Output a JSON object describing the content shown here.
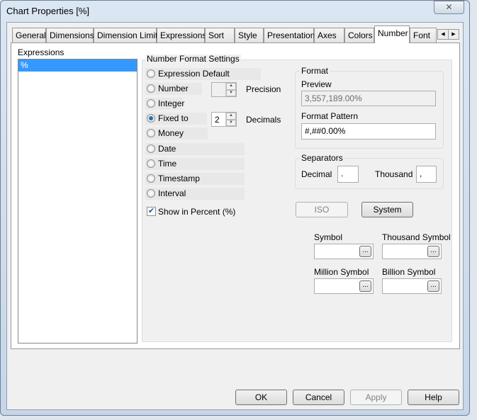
{
  "window": {
    "title": "Chart Properties [%]",
    "close": "✕"
  },
  "tabs": [
    "General",
    "Dimensions",
    "Dimension Limits",
    "Expressions",
    "Sort",
    "Style",
    "Presentation",
    "Axes",
    "Colors",
    "Number",
    "Font"
  ],
  "active_tab": "Number",
  "expressions": {
    "label": "Expressions",
    "items": [
      "%"
    ]
  },
  "number_format": {
    "label": "Number Format Settings",
    "options": [
      "Expression Default",
      "Number",
      "Integer",
      "Fixed to",
      "Money",
      "Date",
      "Time",
      "Timestamp",
      "Interval"
    ],
    "selected": "Fixed to",
    "precision_label": "Precision",
    "precision_value": "",
    "decimals_label": "Decimals",
    "decimals_value": "2",
    "show_percent_label": "Show in Percent (%)",
    "show_percent_checked": true
  },
  "format": {
    "label": "Format",
    "preview_label": "Preview",
    "preview_value": "3,557,189.00%",
    "pattern_label": "Format Pattern",
    "pattern_value": "#,##0.00%"
  },
  "separators": {
    "label": "Separators",
    "decimal_label": "Decimal",
    "decimal_value": ".",
    "thousand_label": "Thousand",
    "thousand_value": ","
  },
  "iso_label": "ISO",
  "system_label": "System",
  "symbols": {
    "symbol": "Symbol",
    "thousand": "Thousand Symbol",
    "million": "Million Symbol",
    "billion": "Billion Symbol",
    "browse": "..."
  },
  "buttons": {
    "ok": "OK",
    "cancel": "Cancel",
    "apply": "Apply",
    "help": "Help"
  }
}
